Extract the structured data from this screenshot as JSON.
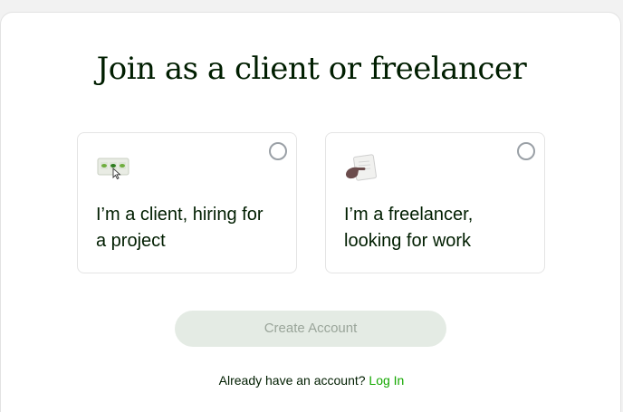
{
  "heading": "Join as a client or freelancer",
  "options": [
    {
      "label": "I’m a client, hiring for a project",
      "icon": "client-hiring-icon",
      "selected": false
    },
    {
      "label": "I’m a freelancer, looking for work",
      "icon": "freelancer-work-icon",
      "selected": false
    }
  ],
  "create_account_label": "Create Account",
  "login_prompt": "Already have an account?",
  "login_link": "Log In",
  "colors": {
    "brand_green": "#14a800",
    "heading_text": "#001e00",
    "disabled_button_bg": "#e4ebe4",
    "disabled_button_text": "#9aa59a"
  }
}
